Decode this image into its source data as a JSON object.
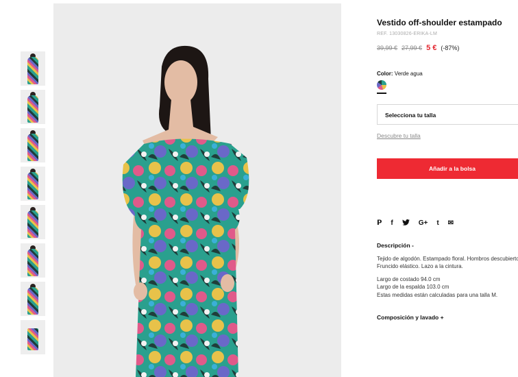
{
  "thumbnails": [
    {
      "name": "thumb-1"
    },
    {
      "name": "thumb-2"
    },
    {
      "name": "thumb-3"
    },
    {
      "name": "thumb-4"
    },
    {
      "name": "thumb-5"
    },
    {
      "name": "thumb-6"
    },
    {
      "name": "thumb-7"
    },
    {
      "name": "thumb-8"
    }
  ],
  "product": {
    "title": "Vestido off-shoulder estampado",
    "ref": "REF. 13030826-ERIKA-LM",
    "price_original_1": "39,99 €",
    "price_original_2": "27,99 €",
    "price_current": "5 €",
    "discount": "(-87%)"
  },
  "color": {
    "label": "Color:",
    "value": "Verde agua"
  },
  "size": {
    "select_label": "Selecciona tu talla",
    "guide_link": "Descubre tu talla"
  },
  "cart": {
    "add_label": "Añadir a la bolsa"
  },
  "share": {
    "pinterest": "𝗣",
    "facebook": "f",
    "twitter": "🐦",
    "google": "G+",
    "tumblr": "t",
    "email": "✉"
  },
  "description": {
    "title": "Descripción -",
    "line1": "Tejido de algodón. Estampado floral. Hombros descubiertos.",
    "line2": "Fruncido elástico. Lazo a la cintura.",
    "measure1": "Largo de costado 94.0 cm",
    "measure2": "Largo de la espalda 103.0 cm",
    "measure3": "Estas medidas están calculadas para una talla M."
  },
  "composition": {
    "title": "Composición y lavado +"
  },
  "colors": {
    "accent": "#ee2a33",
    "price_red": "#e3262f"
  }
}
